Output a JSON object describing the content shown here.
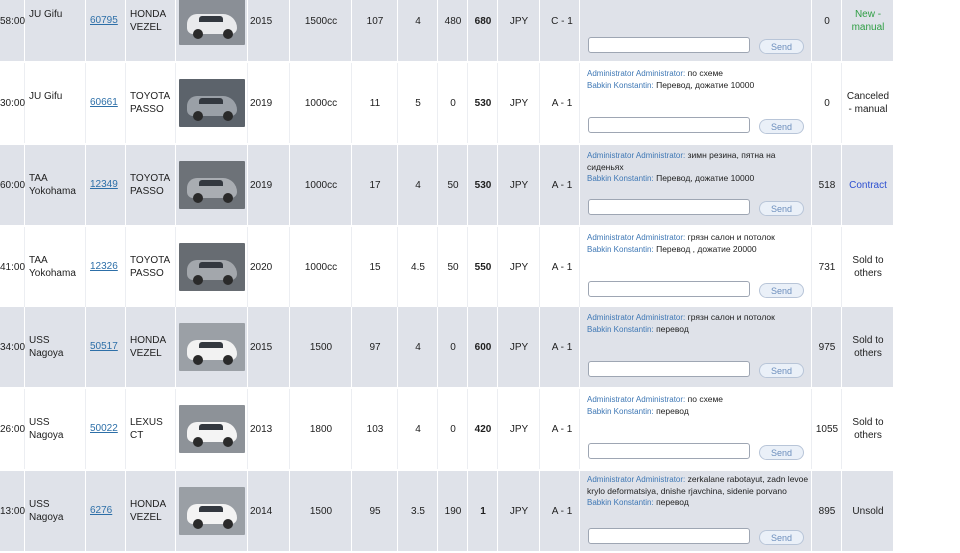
{
  "send_label": "Send",
  "rows": [
    {
      "time": "58:00",
      "auction": "JU Gifu",
      "lot": "60795",
      "make": "HONDA",
      "model": "VEZEL",
      "year": "2015",
      "cc": "1500cc",
      "mileage": "107",
      "score": "4",
      "start": "480",
      "bid": "680",
      "currency": "JPY",
      "grade": "C - 1",
      "comments": [],
      "count": "0",
      "status": "New - manual",
      "status_color": "#2f9e44",
      "car_color": "#e9eaec",
      "bg_color": "#8a8f96"
    },
    {
      "time": "30:00",
      "auction": "JU Gifu",
      "lot": "60661",
      "make": "TOYOTA",
      "model": "PASSO",
      "year": "2019",
      "cc": "1000cc",
      "mileage": "11",
      "score": "5",
      "start": "0",
      "bid": "530",
      "currency": "JPY",
      "grade": "A - 1",
      "comments": [
        {
          "name": "Administrator Administrator:",
          "text": "по схеме"
        },
        {
          "name": "Babkin Konstantin:",
          "text": "Перевод, дожатие 10000"
        }
      ],
      "count": "0",
      "status": "Canceled - manual",
      "status_color": "#1e1e1e",
      "car_color": "#9aa0a7",
      "bg_color": "#5c636b"
    },
    {
      "time": "60:00",
      "auction": "TAA Yokohama",
      "lot": "12349",
      "make": "TOYOTA",
      "model": "PASSO",
      "year": "2019",
      "cc": "1000cc",
      "mileage": "17",
      "score": "4",
      "start": "50",
      "bid": "530",
      "currency": "JPY",
      "grade": "A - 1",
      "comments": [
        {
          "name": "Administrator Administrator:",
          "text": "зимн резина, пятна на сиденьях"
        },
        {
          "name": "Babkin Konstantin:",
          "text": "Перевод, дожатие 10000"
        }
      ],
      "count": "518",
      "status": "Contract",
      "status_color": "#2d4fd0",
      "car_color": "#a9adb2",
      "bg_color": "#6d7278"
    },
    {
      "time": "41:00",
      "auction": "TAA Yokohama",
      "lot": "12326",
      "make": "TOYOTA",
      "model": "PASSO",
      "year": "2020",
      "cc": "1000cc",
      "mileage": "15",
      "score": "4.5",
      "start": "50",
      "bid": "550",
      "currency": "JPY",
      "grade": "A - 1",
      "comments": [
        {
          "name": "Administrator Administrator:",
          "text": "грязн салон и потолок"
        },
        {
          "name": "Babkin Konstantin:",
          "text": "Перевод , дожатие 20000"
        }
      ],
      "count": "731",
      "status": "Sold to others",
      "status_color": "#1e1e1e",
      "car_color": "#a3a7ac",
      "bg_color": "#676c72"
    },
    {
      "time": "34:00",
      "auction": "USS Nagoya",
      "lot": "50517",
      "make": "HONDA",
      "model": "VEZEL",
      "year": "2015",
      "cc": "1500",
      "mileage": "97",
      "score": "4",
      "start": "0",
      "bid": "600",
      "currency": "JPY",
      "grade": "A - 1",
      "comments": [
        {
          "name": "Administrator Administrator:",
          "text": "грязн салон и потолок"
        },
        {
          "name": "Babkin Konstantin:",
          "text": "перевод"
        }
      ],
      "count": "975",
      "status": "Sold to others",
      "status_color": "#1e1e1e",
      "car_color": "#f2f2f2",
      "bg_color": "#9ba0a6"
    },
    {
      "time": "26:00",
      "auction": "USS Nagoya",
      "lot": "50022",
      "make": "LEXUS",
      "model": "CT",
      "year": "2013",
      "cc": "1800",
      "mileage": "103",
      "score": "4",
      "start": "0",
      "bid": "420",
      "currency": "JPY",
      "grade": "A - 1",
      "comments": [
        {
          "name": "Administrator Administrator:",
          "text": "по схеме"
        },
        {
          "name": "Babkin Konstantin:",
          "text": "перевод"
        }
      ],
      "count": "1055",
      "status": "Sold to others",
      "status_color": "#1e1e1e",
      "car_color": "#f4f4f4",
      "bg_color": "#8d9298"
    },
    {
      "time": "13:00",
      "auction": "USS Nagoya",
      "lot": "6276",
      "make": "HONDA",
      "model": "VEZEL",
      "year": "2014",
      "cc": "1500",
      "mileage": "95",
      "score": "3.5",
      "start": "190",
      "bid": "1",
      "currency": "JPY",
      "grade": "A - 1",
      "comments": [
        {
          "name": "Administrator Administrator:",
          "text": "zerkalane rabotayut, zadn levoe krylo deformatsiya, dnishe rjavchina, sidenie porvano"
        },
        {
          "name": "Babkin Konstantin:",
          "text": "перевод"
        }
      ],
      "count": "895",
      "status": "Unsold",
      "status_color": "#1e1e1e",
      "car_color": "#f3f3f3",
      "bg_color": "#9a9fa5"
    }
  ]
}
